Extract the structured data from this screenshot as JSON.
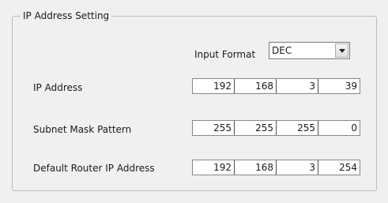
{
  "group": {
    "title": "IP Address Setting"
  },
  "input_format": {
    "label": "Input Format",
    "value": "DEC",
    "icon": "chevron-down-icon"
  },
  "fields": [
    {
      "label": "IP Address",
      "octets": [
        "192",
        "168",
        "3",
        "39"
      ]
    },
    {
      "label": "Subnet Mask Pattern",
      "octets": [
        "255",
        "255",
        "255",
        "0"
      ]
    },
    {
      "label": "Default Router IP Address",
      "octets": [
        "192",
        "168",
        "3",
        "254"
      ]
    }
  ]
}
